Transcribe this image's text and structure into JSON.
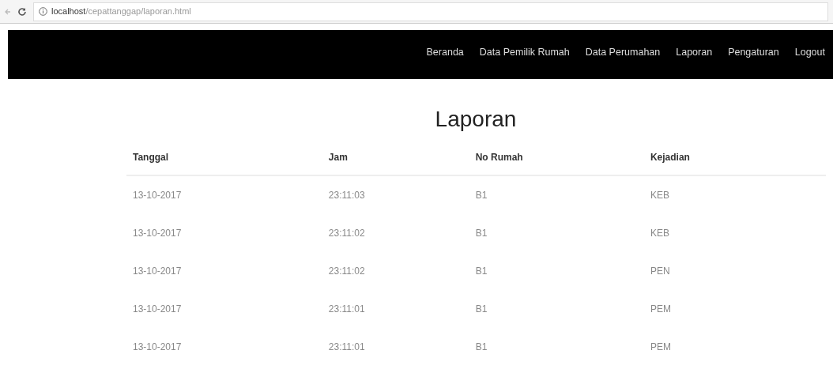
{
  "browser": {
    "url": "**localhost**/cepattanggap/laporan.html"
  },
  "navbar": {
    "items": [
      "Beranda",
      "Data Pemilik Rumah",
      "Data Perumahan",
      "Laporan",
      "Pengaturan",
      "Logout"
    ]
  },
  "page": {
    "title": "Laporan"
  },
  "table": {
    "columns": [
      "Tanggal",
      "Jam",
      "No Rumah",
      "Kejadian"
    ],
    "rows": [
      [
        "13-10-2017",
        "23:11:03",
        "B1",
        "KEB"
      ],
      [
        "13-10-2017",
        "23:11:02",
        "B1",
        "KEB"
      ],
      [
        "13-10-2017",
        "23:11:02",
        "B1",
        "PEN"
      ],
      [
        "13-10-2017",
        "23:11:01",
        "B1",
        "PEM"
      ],
      [
        "13-10-2017",
        "23:11:01",
        "B1",
        "PEM"
      ]
    ]
  }
}
